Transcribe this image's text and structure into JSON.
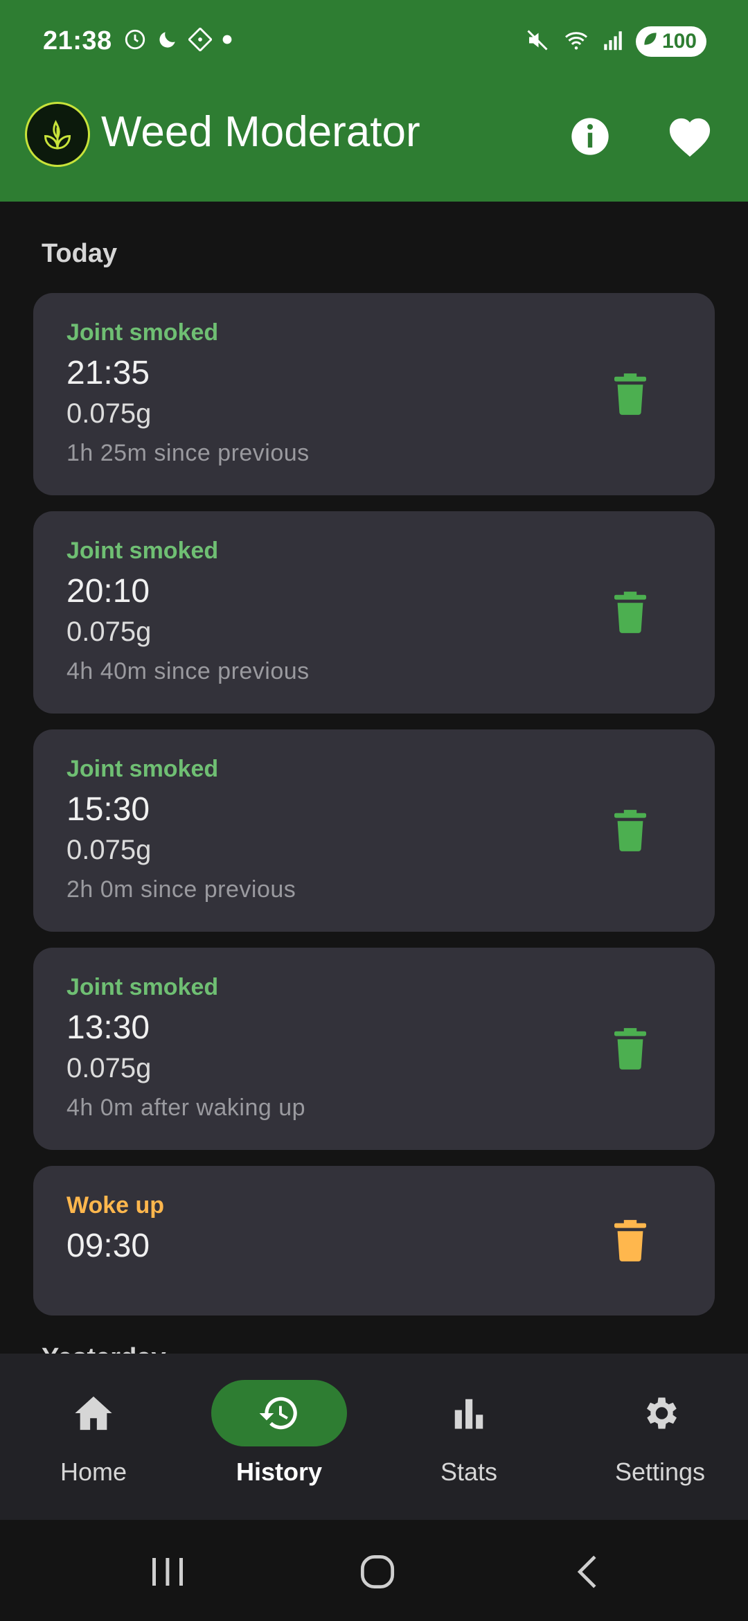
{
  "status_bar": {
    "time": "21:38",
    "battery": "100"
  },
  "app_bar": {
    "title": "Weed Moderator",
    "icons": [
      "leaf-logo-icon",
      "info-icon",
      "heart-icon"
    ]
  },
  "sections": [
    {
      "title": "Today",
      "entries": [
        {
          "type": "Joint smoked",
          "time": "21:35",
          "amount": "0.075g",
          "note": "1h 25m since previous",
          "color": "#6fbf73"
        },
        {
          "type": "Joint smoked",
          "time": "20:10",
          "amount": "0.075g",
          "note": "4h 40m since previous",
          "color": "#6fbf73"
        },
        {
          "type": "Joint smoked",
          "time": "15:30",
          "amount": "0.075g",
          "note": "2h 0m since previous",
          "color": "#6fbf73"
        },
        {
          "type": "Joint smoked",
          "time": "13:30",
          "amount": "0.075g",
          "note": "4h 0m after waking up",
          "color": "#6fbf73"
        },
        {
          "type": "Woke up",
          "time": "09:30",
          "color": "#ffb74d"
        }
      ]
    },
    {
      "title": "Yesterday"
    }
  ],
  "bottom_nav": {
    "items": [
      {
        "label": "Home",
        "icon": "home-icon"
      },
      {
        "label": "History",
        "icon": "history-icon",
        "selected": true
      },
      {
        "label": "Stats",
        "icon": "bar-chart-icon"
      },
      {
        "label": "Settings",
        "icon": "gear-icon"
      }
    ]
  },
  "colors": {
    "primary": "#2e7d32",
    "smoke_accent": "#6fbf73",
    "wake_accent": "#ffb74d",
    "card": "#33323a",
    "background": "#141414"
  }
}
